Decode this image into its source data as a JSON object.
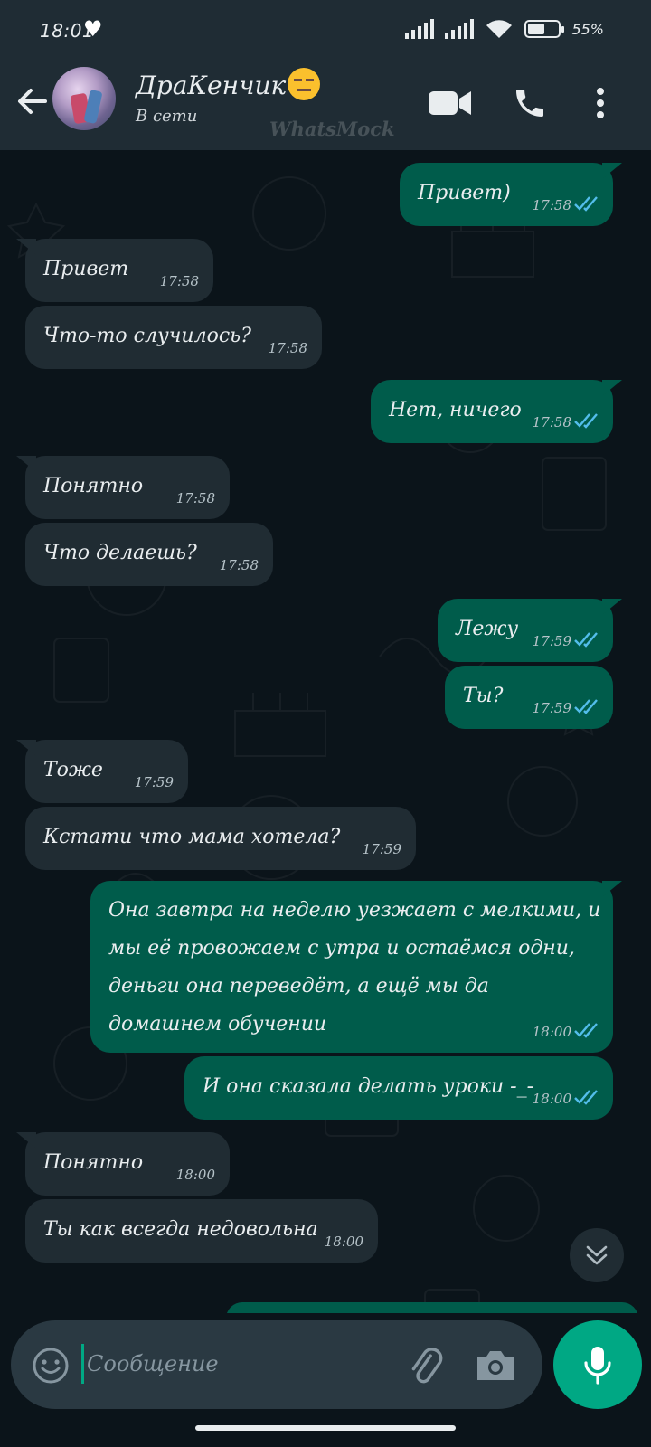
{
  "status_bar": {
    "time": "18:01",
    "battery_percent": "55%",
    "battery_level": 0.55
  },
  "header": {
    "contact_name": "ДраКенчик",
    "contact_emoji": "expressionless-face-emoji",
    "status": "В сети",
    "watermark": "WhatsMock",
    "icons": [
      "back-arrow-icon",
      "video-call-icon",
      "voice-call-icon",
      "more-options-icon"
    ]
  },
  "messages": [
    {
      "dir": "out",
      "text": "Привет)",
      "time": "17:58",
      "read": true
    },
    {
      "dir": "in",
      "text": "Привет",
      "time": "17:58"
    },
    {
      "dir": "in",
      "text": "Что-то случилось?",
      "time": "17:58"
    },
    {
      "dir": "out",
      "text": "Нет, ничего",
      "time": "17:58",
      "read": true
    },
    {
      "dir": "in",
      "text": "Понятно",
      "time": "17:58"
    },
    {
      "dir": "in",
      "text": "Что делаешь?",
      "time": "17:58"
    },
    {
      "dir": "out",
      "text": "Лежу",
      "time": "17:59",
      "read": true
    },
    {
      "dir": "out",
      "text": "Ты?",
      "time": "17:59",
      "read": true
    },
    {
      "dir": "in",
      "text": "Тоже",
      "time": "17:59"
    },
    {
      "dir": "in",
      "text": "Кстати что мама хотела?",
      "time": "17:59"
    },
    {
      "dir": "out",
      "text": "Она завтра на неделю уезжает с мелкими, и мы её провожаем с утра и остаёмся одни, деньги она переведёт, а ещё мы да домашнем обучении",
      "time": "18:00",
      "read": true
    },
    {
      "dir": "out",
      "text": "И она сказала делать уроки -_-",
      "time": "18:00",
      "read": true
    },
    {
      "dir": "in",
      "text": "Понятно",
      "time": "18:00"
    },
    {
      "dir": "in",
      "text": "Ты как всегда недовольна",
      "time": "18:00"
    }
  ],
  "input": {
    "placeholder": "Сообщение",
    "value": ""
  },
  "colors": {
    "header_bg": "#1f2c34",
    "chat_bg": "#0b141a",
    "incoming_bubble": "#202c33",
    "outgoing_bubble": "#005c4b",
    "read_ticks": "#53bdeb",
    "accent": "#00a884"
  }
}
